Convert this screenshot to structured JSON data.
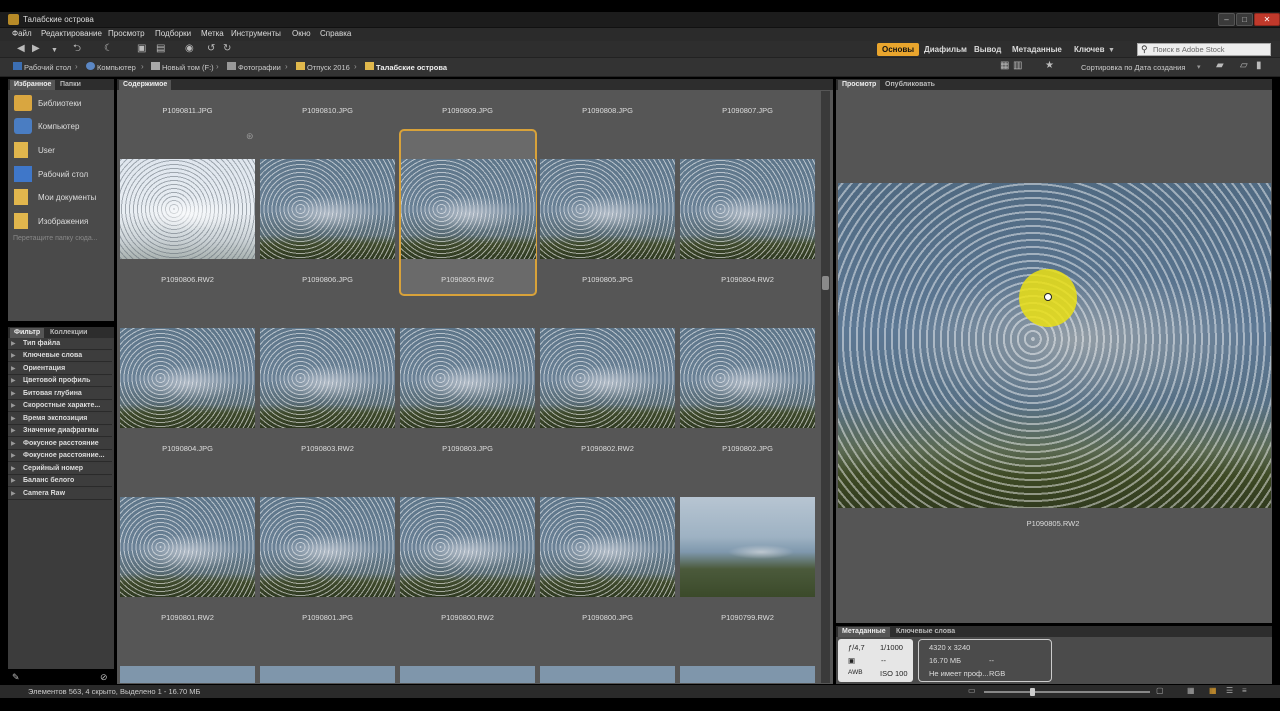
{
  "window": {
    "title": "Талабские острова"
  },
  "menu": [
    "Файл",
    "Редактирование",
    "Просмотр",
    "Подборки",
    "Метка",
    "Инструменты",
    "Окно",
    "Справка"
  ],
  "workspaces": {
    "active": "Основы",
    "items": [
      "Диафильм",
      "Вывод",
      "Метаданные",
      "Ключев"
    ]
  },
  "search": {
    "placeholder": "Поиск в Adobe Stock"
  },
  "breadcrumb": [
    "Рабочий стол",
    "Компьютер",
    "Новый том (F:)",
    "Фотографии",
    "Отпуск 2016",
    "Талабские острова"
  ],
  "sort": {
    "label": "Сортировка по Дата создания"
  },
  "favorites_panel": {
    "tabs": [
      "Избранное",
      "Папки"
    ],
    "items": [
      "Библиотеки",
      "Компьютер",
      "User",
      "Рабочий стол",
      "Мои документы",
      "Изображения"
    ],
    "drop_hint": "Перетащите папку сюда..."
  },
  "filter_panel": {
    "tabs": [
      "Фильтр",
      "Коллекции"
    ],
    "items": [
      "Тип файла",
      "Ключевые слова",
      "Ориентация",
      "Цветовой профиль",
      "Битовая глубина",
      "Скоростные характе...",
      "Время экспозиция",
      "Значение диафрагмы",
      "Фокусное расстояние",
      "Фокусное расстояние...",
      "Серийный номер",
      "Баланс белого",
      "Camera Raw"
    ]
  },
  "content": {
    "tab": "Содержимое",
    "top_row_labels": [
      "P1090811.JPG",
      "P1090810.JPG",
      "P1090809.JPG",
      "P1090808.JPG",
      "P1090807.JPG"
    ],
    "rows": [
      [
        "P1090806.RW2",
        "P1090806.JPG",
        "P1090805.RW2",
        "P1090805.JPG",
        "P1090804.RW2"
      ],
      [
        "P1090804.JPG",
        "P1090803.RW2",
        "P1090803.JPG",
        "P1090802.RW2",
        "P1090802.JPG"
      ],
      [
        "P1090801.RW2",
        "P1090801.JPG",
        "P1090800.RW2",
        "P1090800.JPG",
        "P1090799.RW2"
      ]
    ],
    "selected": "P1090805.RW2"
  },
  "preview": {
    "tabs": [
      "Просмотр",
      "Опубликовать"
    ],
    "filename": "P1090805.RW2"
  },
  "metadata_panel": {
    "tabs": [
      "Метаданные",
      "Ключевые слова"
    ],
    "aperture": "ƒ/4,7",
    "shutter": "1/1000",
    "wb": "AWB",
    "iso": "ISO 100",
    "dash": "--",
    "dimensions": "4320 x 3240",
    "size": "16.70 МБ",
    "profile": "Не имеет проф...",
    "color_mode": "RGB"
  },
  "status": {
    "text": "Элементов 563, 4 скрыто, Выделено 1 - 16.70 МБ"
  },
  "colors": {
    "accent": "#e9a52d",
    "selection": "#d8a23a",
    "panel": "#4a4a4a"
  }
}
